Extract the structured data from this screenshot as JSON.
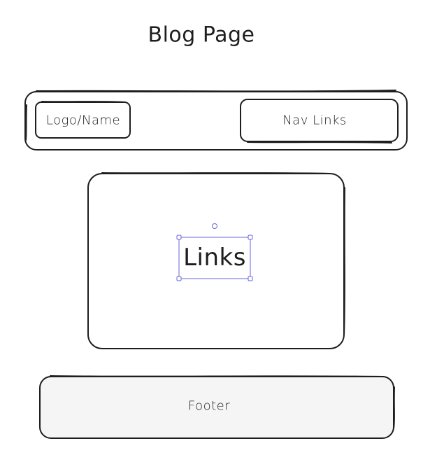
{
  "title": "Blog Page",
  "header": {
    "logo_label": "Logo/Name",
    "nav_label": "Nav Links"
  },
  "main": {
    "label": "Links"
  },
  "footer": {
    "label": "Footer"
  },
  "colors": {
    "stroke": "#1e1e1e",
    "selection": "#6965db",
    "footer_fill": "#f5f5f5"
  }
}
